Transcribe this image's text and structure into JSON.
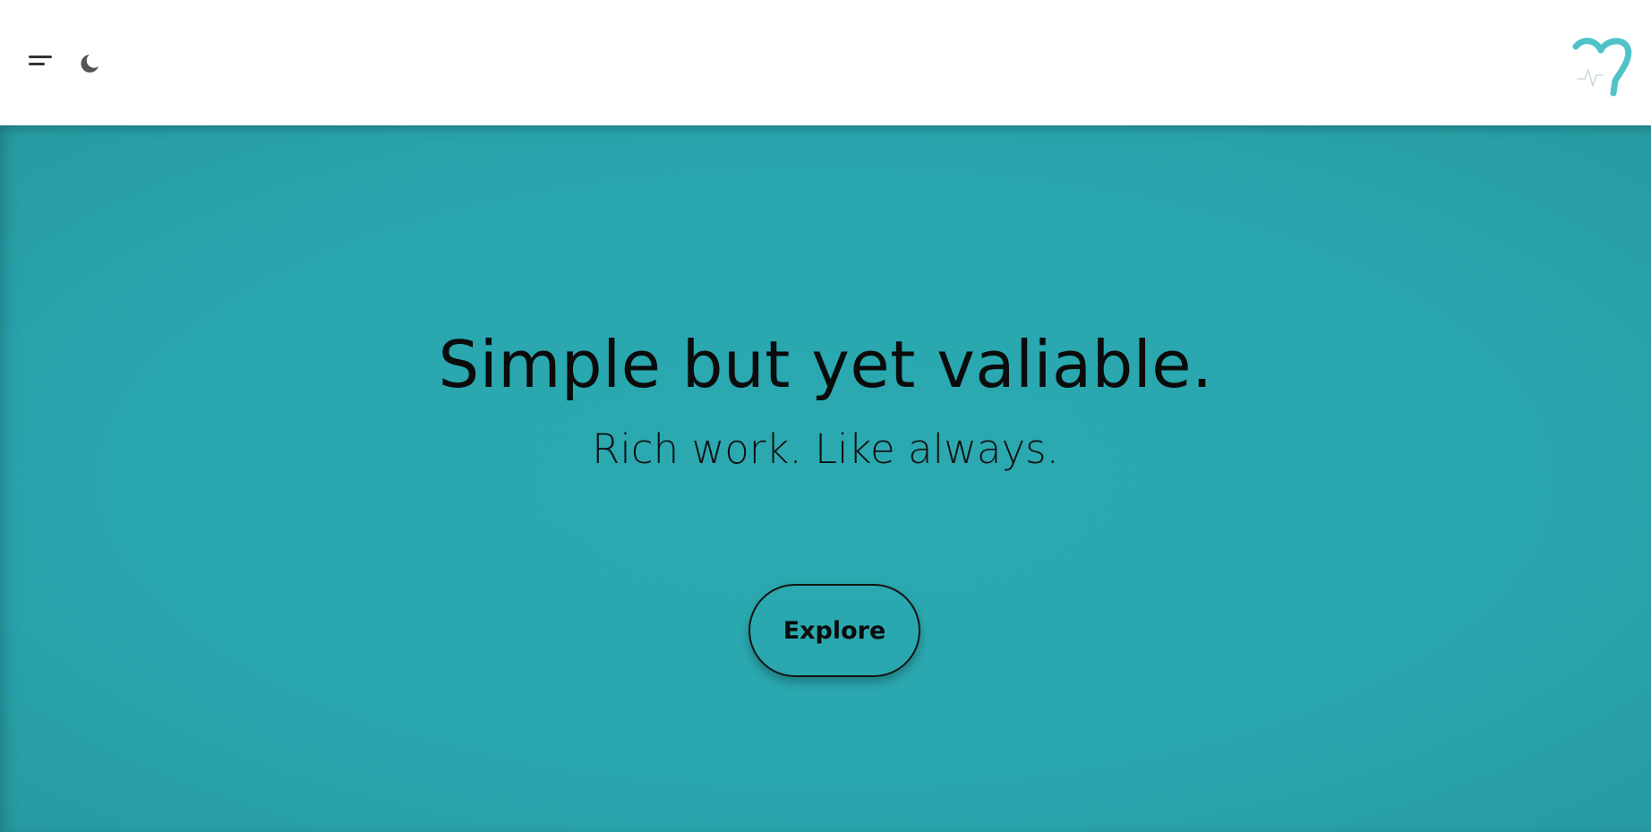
{
  "header": {
    "menu_icon": "menu-icon",
    "theme_toggle_icon": "moon-icon",
    "logo_icon": "heart-logo-icon",
    "logo_color": "#4fc3c8"
  },
  "hero": {
    "headline": "Simple but yet valiable.",
    "subheadline": "Rich work. Like always.",
    "cta_label": "Explore",
    "background_color": "#2aa8b0"
  }
}
